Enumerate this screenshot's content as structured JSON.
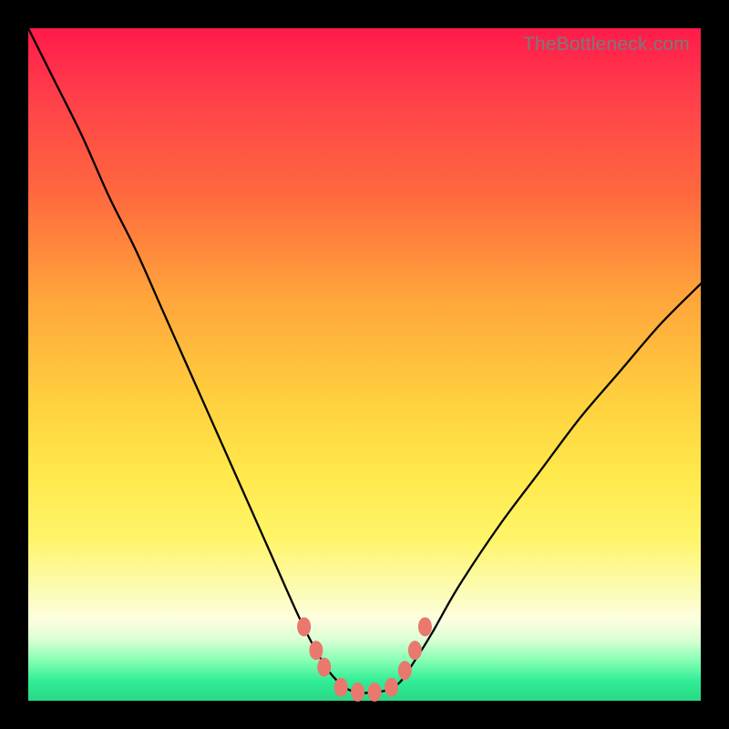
{
  "watermark": "TheBottleneck.com",
  "colors": {
    "frame": "#000000",
    "watermark_text": "#7a7a7a",
    "curve_stroke": "#000000",
    "marker_fill": "#e9786f",
    "marker_stroke": "#d85a52",
    "gradient_stops": [
      "#ff1a4a",
      "#ff3e4a",
      "#ff6a3e",
      "#ffa53b",
      "#ffcf3e",
      "#ffe84a",
      "#fff56a",
      "#fcfcb8",
      "#fdfee0",
      "#d9ffd4",
      "#86ffb4",
      "#33ee96",
      "#28d885"
    ]
  },
  "chart_data": {
    "type": "line",
    "title": "",
    "xlabel": "",
    "ylabel": "",
    "xlim": [
      0,
      100
    ],
    "ylim": [
      0,
      100
    ],
    "grid": false,
    "legend": false,
    "note": "Values approximated from pixel positions; axes are unitless 0–100 in plot-area coordinates (y=0 at bottom).",
    "series": [
      {
        "name": "bottleneck-curve",
        "x": [
          0,
          4,
          8,
          12,
          16,
          20,
          24,
          28,
          32,
          36,
          40,
          42.5,
          45,
          48,
          52,
          55,
          57.5,
          60,
          64,
          70,
          76,
          82,
          88,
          94,
          100
        ],
        "y": [
          100,
          92,
          84,
          75,
          67,
          58,
          49,
          40,
          31,
          22,
          13,
          8,
          4,
          1.5,
          1.3,
          2.5,
          6,
          10,
          17,
          26,
          34,
          42,
          49,
          56,
          62
        ]
      }
    ],
    "markers": {
      "name": "highlight-points",
      "note": "Small pink lozenges near the trough of the curve.",
      "points": [
        {
          "x": 41.0,
          "y": 11.0
        },
        {
          "x": 42.8,
          "y": 7.5
        },
        {
          "x": 44.0,
          "y": 5.0
        },
        {
          "x": 46.5,
          "y": 2.0
        },
        {
          "x": 49.0,
          "y": 1.3
        },
        {
          "x": 51.5,
          "y": 1.3
        },
        {
          "x": 54.0,
          "y": 2.0
        },
        {
          "x": 56.0,
          "y": 4.5
        },
        {
          "x": 57.5,
          "y": 7.5
        },
        {
          "x": 59.0,
          "y": 11.0
        }
      ]
    }
  }
}
